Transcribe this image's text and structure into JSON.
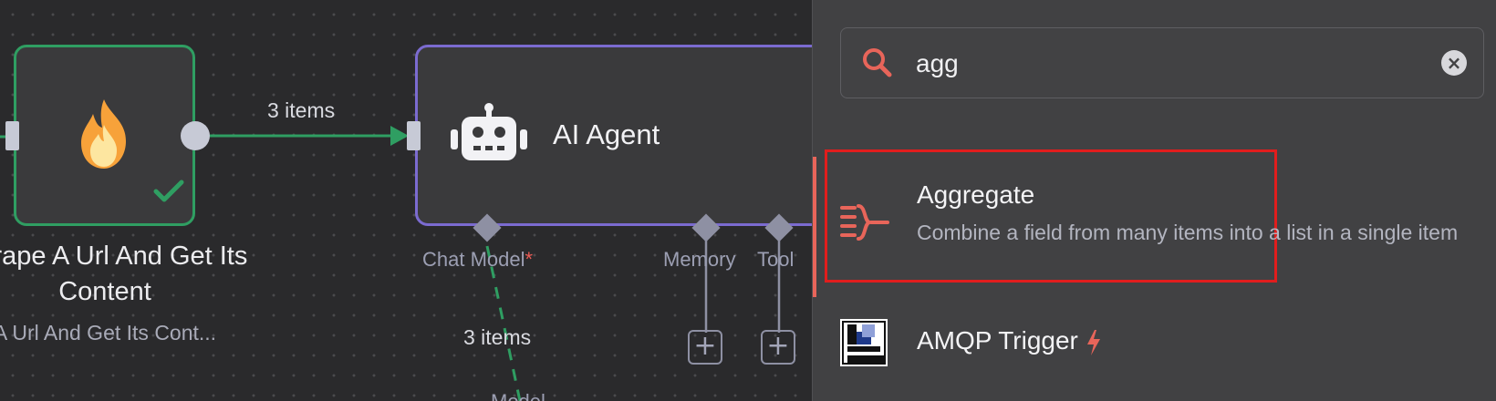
{
  "canvas": {
    "scrape_node": {
      "title": "Scrape A Url And Get Its Content",
      "subtitle": "A Url And Get Its Cont...",
      "icon": "fire-icon",
      "status": "check-icon"
    },
    "link_main_label": "3 items",
    "agent_node": {
      "title": "AI Agent",
      "icon": "robot-icon",
      "inputs": [
        {
          "label": "Chat Model",
          "required_mark": "*"
        },
        {
          "label": "Memory"
        },
        {
          "label": "Tool"
        }
      ]
    },
    "link_model_label": "3 items",
    "truncated_label": "Model"
  },
  "panel": {
    "search": {
      "value": "agg",
      "icon": "search-icon",
      "clear_icon": "clear-icon"
    },
    "results": [
      {
        "title": "Aggregate",
        "description": "Combine a field from many items into a list in a single item",
        "icon": "aggregate-icon",
        "highlighted": true
      },
      {
        "title": "AMQP Trigger",
        "icon": "amqp-icon",
        "badge_icon": "bolt-icon"
      }
    ]
  },
  "colors": {
    "success": "#2f9e62",
    "agent_border": "#7b6bd0",
    "accent": "#e8655a",
    "highlight_box": "#e11d1d"
  }
}
